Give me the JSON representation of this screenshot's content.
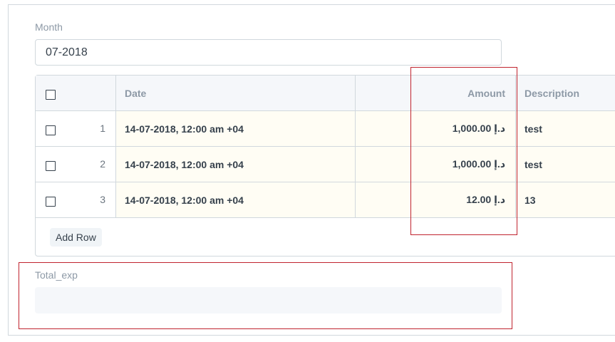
{
  "month": {
    "label": "Month",
    "value": "07-2018"
  },
  "table": {
    "columns": {
      "date": "Date",
      "amount": "Amount",
      "description": "Description"
    },
    "rows": [
      {
        "idx": "1",
        "date": "14-07-2018, 12:00 am +04",
        "amount": "د.إ 1,000.00",
        "description": "test"
      },
      {
        "idx": "2",
        "date": "14-07-2018, 12:00 am +04",
        "amount": "د.إ 1,000.00",
        "description": "test"
      },
      {
        "idx": "3",
        "date": "14-07-2018, 12:00 am +04",
        "amount": "د.إ 12.00",
        "description": "13"
      }
    ],
    "add_row_label": "Add Row"
  },
  "total": {
    "label": "Total_exp",
    "value": ""
  },
  "colors": {
    "annotation": "#c0242f",
    "highlight_cell": "#fffdf4",
    "header_bg": "#f5f7fa"
  }
}
